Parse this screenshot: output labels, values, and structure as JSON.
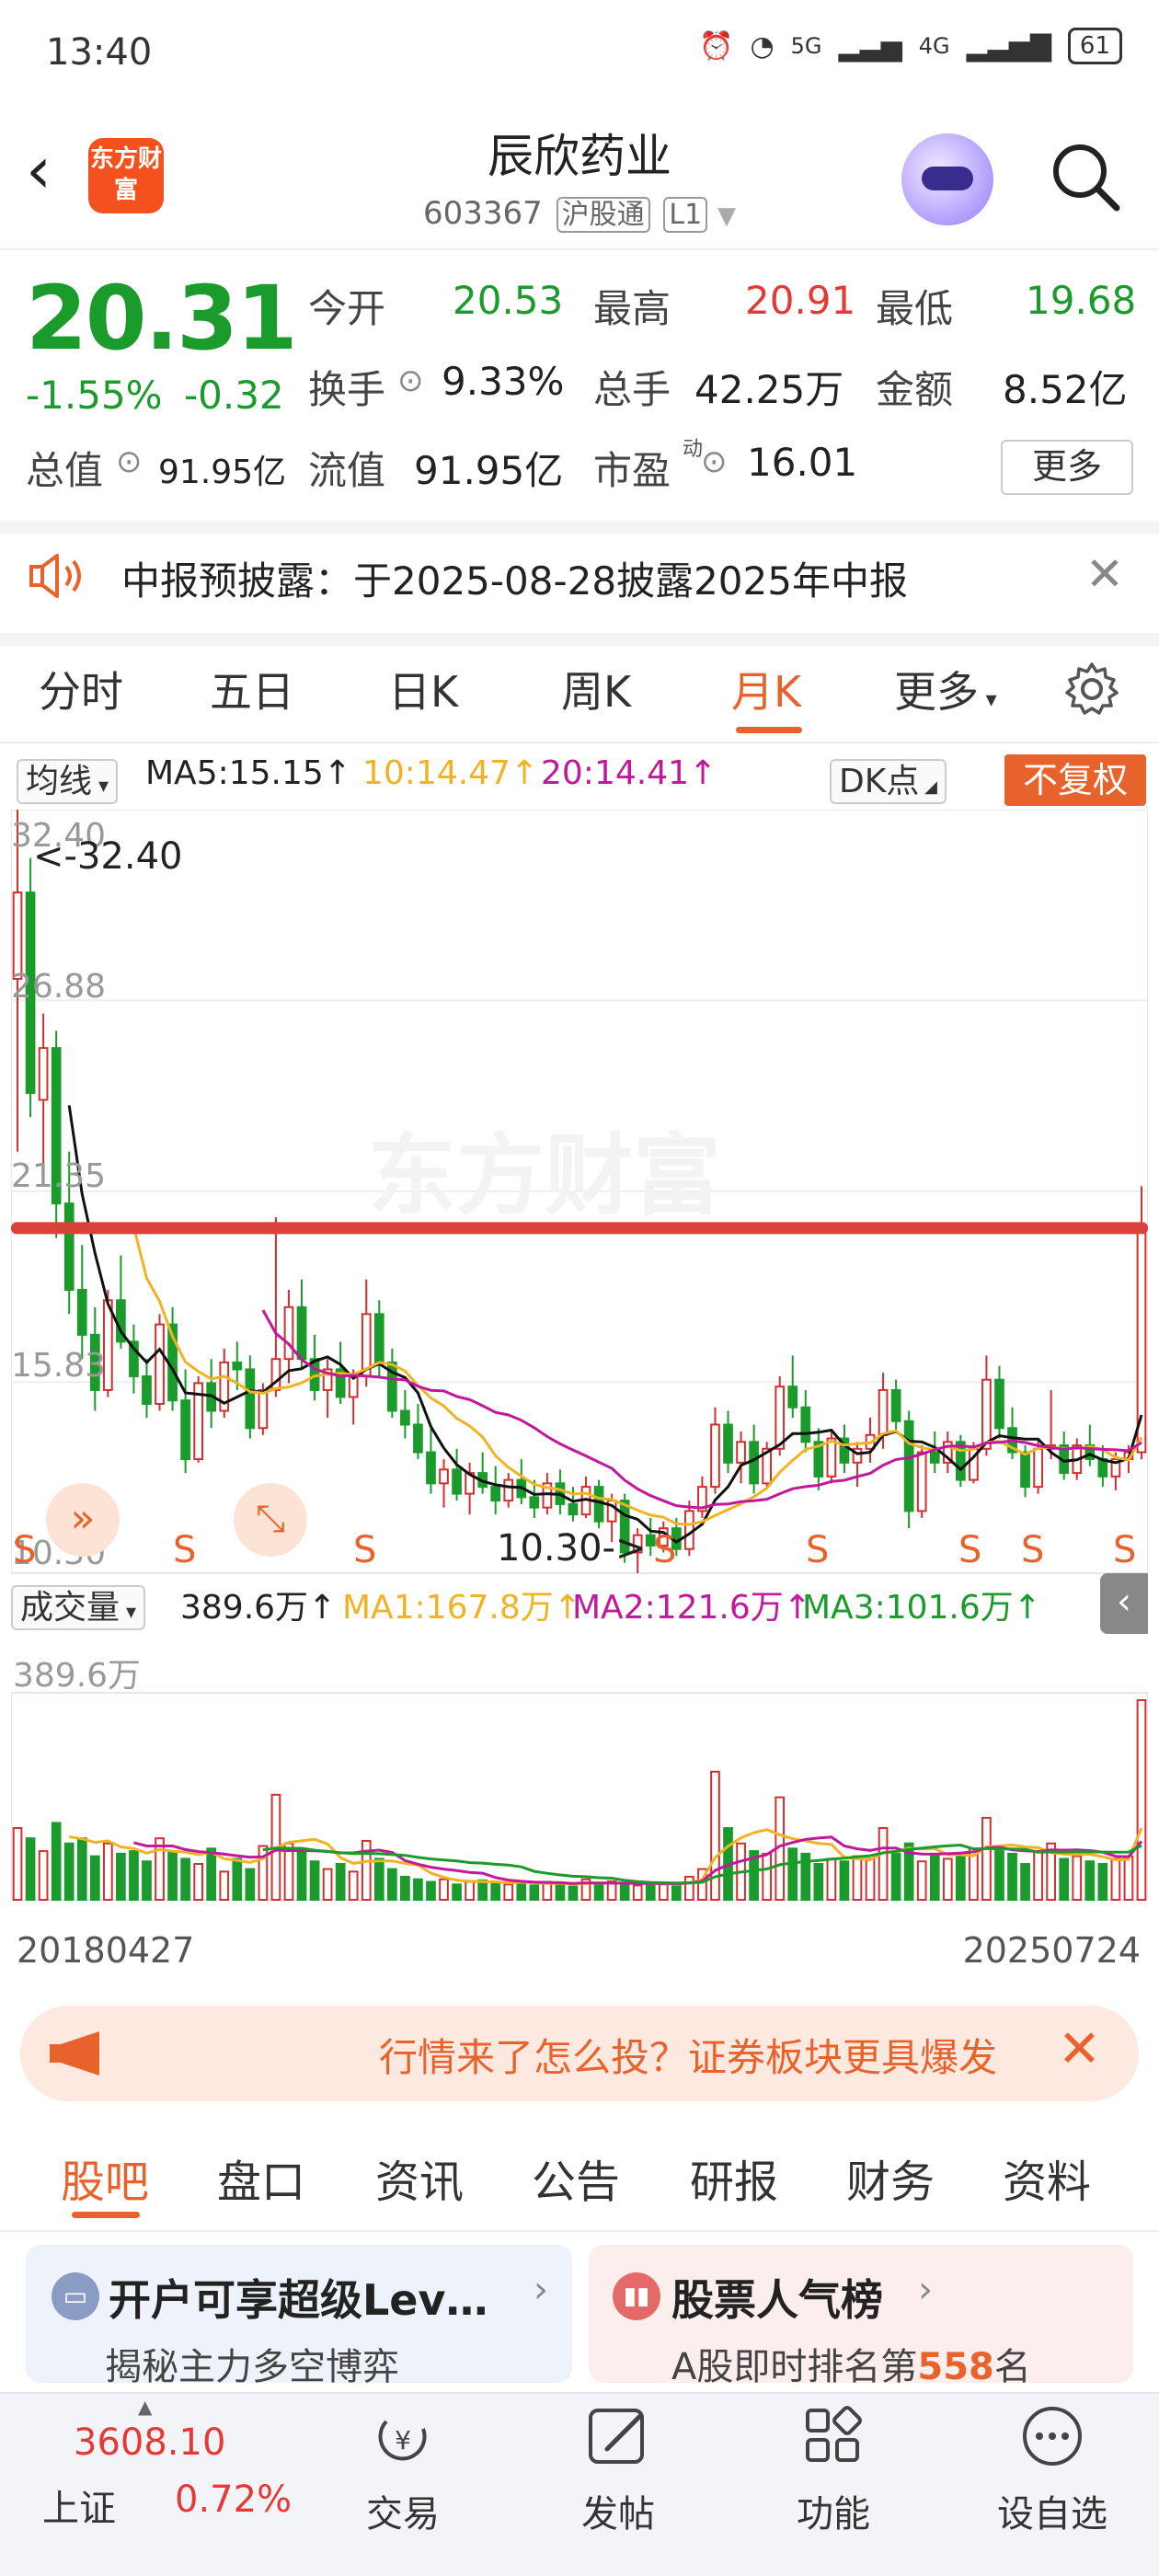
{
  "status": {
    "time": "13:40",
    "net1": "5G",
    "net2": "4G",
    "battery": "61"
  },
  "header": {
    "title": "辰欣药业",
    "code": "603367",
    "exchange_tag": "沪股通",
    "level_tag": "L1",
    "logo_text": "东方财富"
  },
  "quote": {
    "price": "20.31",
    "change_pct": "-1.55%",
    "change": "-0.32",
    "open_label": "今开",
    "open": "20.53",
    "high_label": "最高",
    "high": "20.91",
    "low_label": "最低",
    "low": "19.68",
    "turnover_label": "换手",
    "turnover": "9.33%",
    "volume_label": "总手",
    "volume": "42.25万",
    "amount_label": "金额",
    "amount": "8.52亿",
    "mktcap_label": "总值",
    "mktcap": "91.95亿",
    "float_label": "流值",
    "float": "91.95亿",
    "pe_label": "市盈",
    "pe_sup": "动",
    "pe": "16.01",
    "more": "更多"
  },
  "notice": {
    "text": "中报预披露：于2025-08-28披露2025年中报"
  },
  "chart_tabs": [
    "分时",
    "五日",
    "日K",
    "周K",
    "月K",
    "更多"
  ],
  "active_chart_tab": "月K",
  "ma": {
    "label": "均线",
    "ma5": "MA5:15.15",
    "ma10": "10:14.47",
    "ma20": "20:14.41",
    "dk": "DK点",
    "fq": "不复权"
  },
  "volume_row": {
    "label": "成交量",
    "value": "389.6万",
    "ma1": "MA1:167.8万",
    "ma2": "MA2:121.6万",
    "ma3": "MA3:101.6万",
    "axis_max": "389.6万"
  },
  "colors": {
    "up": "#d32f2f",
    "down": "#1a9b2b",
    "ma5": "#111111",
    "ma10": "#f0b323",
    "ma20": "#c2189b",
    "accent": "#e8632b",
    "drawn_line": "#d9413a"
  },
  "chart_data": {
    "type": "candlestick",
    "period": "monthly",
    "x_start": "20180427",
    "x_end": "20250724",
    "y_ticks": [
      "32.40",
      "26.88",
      "21.35",
      "15.83",
      "10.30"
    ],
    "ylim": [
      10.3,
      32.4
    ],
    "high_marker": "<-32.40",
    "low_marker": "10.30->",
    "horizontal_line_price": 20.3,
    "signal_markers": [
      "S",
      "S",
      "S",
      "S",
      "S",
      "S",
      "S",
      "S"
    ],
    "candles_ohlc": [
      [
        27.5,
        32.4,
        22.5,
        30.0
      ],
      [
        30.0,
        31.0,
        23.5,
        24.2
      ],
      [
        24.0,
        26.5,
        22.0,
        25.5
      ],
      [
        25.5,
        26.0,
        20.0,
        21.0
      ],
      [
        21.0,
        22.5,
        17.8,
        18.5
      ],
      [
        18.5,
        19.8,
        16.5,
        17.2
      ],
      [
        17.2,
        18.0,
        15.0,
        15.6
      ],
      [
        15.6,
        18.5,
        15.4,
        18.2
      ],
      [
        18.2,
        19.5,
        16.8,
        17.0
      ],
      [
        17.0,
        17.5,
        15.5,
        16.0
      ],
      [
        16.0,
        16.5,
        14.8,
        15.2
      ],
      [
        15.2,
        17.8,
        15.0,
        17.5
      ],
      [
        17.5,
        18.0,
        15.0,
        15.3
      ],
      [
        15.3,
        16.2,
        13.2,
        13.6
      ],
      [
        13.6,
        16.0,
        13.5,
        15.8
      ],
      [
        15.8,
        16.5,
        14.5,
        15.0
      ],
      [
        15.0,
        16.8,
        14.8,
        16.4
      ],
      [
        16.4,
        17.0,
        15.6,
        16.2
      ],
      [
        16.2,
        16.6,
        14.2,
        14.5
      ],
      [
        14.5,
        15.8,
        14.3,
        15.6
      ],
      [
        15.6,
        20.6,
        15.4,
        16.5
      ],
      [
        16.5,
        18.5,
        15.8,
        18.0
      ],
      [
        18.0,
        18.8,
        16.2,
        16.5
      ],
      [
        16.5,
        17.2,
        15.3,
        15.6
      ],
      [
        15.6,
        16.5,
        14.8,
        16.2
      ],
      [
        16.2,
        17.0,
        15.2,
        15.4
      ],
      [
        15.4,
        16.2,
        14.6,
        16.0
      ],
      [
        16.0,
        18.8,
        15.7,
        17.8
      ],
      [
        17.8,
        18.2,
        16.0,
        16.4
      ],
      [
        16.4,
        16.8,
        14.8,
        15.0
      ],
      [
        15.0,
        15.6,
        14.2,
        14.6
      ],
      [
        14.6,
        15.2,
        13.6,
        13.8
      ],
      [
        13.8,
        14.5,
        12.6,
        12.9
      ],
      [
        12.9,
        13.6,
        12.2,
        13.3
      ],
      [
        13.3,
        13.9,
        12.4,
        12.6
      ],
      [
        12.6,
        13.5,
        12.0,
        13.2
      ],
      [
        13.2,
        13.8,
        12.6,
        12.8
      ],
      [
        12.8,
        13.4,
        12.0,
        12.4
      ],
      [
        12.4,
        13.2,
        12.2,
        13.0
      ],
      [
        13.0,
        13.6,
        12.3,
        12.5
      ],
      [
        12.5,
        13.0,
        11.9,
        12.2
      ],
      [
        12.2,
        13.2,
        12.0,
        12.9
      ],
      [
        12.9,
        13.3,
        12.0,
        12.3
      ],
      [
        12.3,
        12.8,
        11.8,
        12.0
      ],
      [
        12.0,
        13.1,
        11.9,
        12.8
      ],
      [
        12.8,
        13.0,
        11.6,
        11.8
      ],
      [
        11.8,
        12.6,
        11.2,
        12.4
      ],
      [
        12.4,
        12.6,
        10.6,
        10.9
      ],
      [
        10.9,
        11.6,
        10.3,
        11.4
      ],
      [
        11.4,
        11.9,
        10.8,
        11.1
      ],
      [
        11.1,
        11.8,
        10.9,
        11.6
      ],
      [
        11.6,
        11.9,
        10.8,
        11.0
      ],
      [
        11.0,
        12.4,
        10.8,
        12.1
      ],
      [
        12.1,
        13.1,
        11.9,
        12.8
      ],
      [
        12.8,
        15.1,
        12.6,
        14.6
      ],
      [
        14.6,
        15.0,
        13.2,
        13.5
      ],
      [
        13.5,
        14.4,
        12.9,
        14.1
      ],
      [
        14.1,
        14.6,
        12.6,
        12.9
      ],
      [
        12.9,
        14.1,
        12.8,
        13.9
      ],
      [
        13.9,
        16.0,
        13.7,
        15.7
      ],
      [
        15.7,
        16.6,
        14.8,
        15.1
      ],
      [
        15.1,
        15.6,
        13.8,
        14.1
      ],
      [
        14.1,
        14.5,
        12.7,
        13.1
      ],
      [
        13.1,
        14.4,
        12.9,
        14.2
      ],
      [
        14.2,
        14.6,
        13.2,
        13.5
      ],
      [
        13.5,
        14.1,
        12.8,
        13.9
      ],
      [
        13.9,
        14.8,
        13.5,
        14.3
      ],
      [
        14.3,
        16.1,
        13.9,
        15.6
      ],
      [
        15.6,
        15.9,
        14.4,
        14.7
      ],
      [
        14.7,
        15.0,
        11.6,
        12.1
      ],
      [
        12.1,
        14.0,
        11.9,
        13.8
      ],
      [
        13.8,
        14.4,
        13.2,
        13.5
      ],
      [
        13.5,
        14.4,
        13.2,
        14.1
      ],
      [
        14.1,
        14.3,
        12.8,
        13.0
      ],
      [
        13.0,
        14.1,
        12.9,
        13.9
      ],
      [
        13.9,
        16.6,
        13.7,
        15.9
      ],
      [
        15.9,
        16.3,
        14.2,
        14.5
      ],
      [
        14.5,
        15.1,
        13.6,
        13.8
      ],
      [
        13.8,
        14.0,
        12.5,
        12.8
      ],
      [
        12.8,
        14.2,
        12.6,
        13.9
      ],
      [
        13.9,
        15.6,
        13.6,
        14.0
      ],
      [
        14.0,
        14.4,
        13.0,
        13.2
      ],
      [
        13.2,
        14.2,
        13.0,
        14.0
      ],
      [
        14.0,
        14.6,
        13.4,
        13.6
      ],
      [
        13.6,
        14.0,
        12.8,
        13.1
      ],
      [
        13.1,
        13.8,
        12.7,
        13.6
      ],
      [
        13.6,
        14.0,
        13.2,
        13.8
      ],
      [
        13.8,
        21.5,
        13.6,
        20.3
      ]
    ],
    "volumes_wan": [
      140,
      120,
      95,
      150,
      110,
      120,
      85,
      110,
      90,
      95,
      75,
      120,
      95,
      80,
      70,
      100,
      55,
      80,
      60,
      105,
      205,
      110,
      95,
      75,
      60,
      70,
      55,
      115,
      80,
      60,
      45,
      40,
      35,
      40,
      30,
      35,
      38,
      32,
      30,
      36,
      28,
      35,
      30,
      26,
      40,
      32,
      36,
      30,
      28,
      34,
      30,
      28,
      45,
      60,
      250,
      140,
      110,
      95,
      90,
      200,
      100,
      90,
      70,
      80,
      75,
      85,
      80,
      140,
      90,
      110,
      75,
      85,
      80,
      90,
      100,
      160,
      95,
      90,
      70,
      95,
      110,
      80,
      85,
      75,
      70,
      80,
      85,
      389.6
    ]
  },
  "banner": {
    "text": "行情来了怎么投？证券板块更具爆发"
  },
  "bottom_tabs": [
    "股吧",
    "盘口",
    "资讯",
    "公告",
    "研报",
    "财务",
    "资料"
  ],
  "cards": [
    {
      "title": "开户可享超级Lev…",
      "sub": "揭秘主力多空博弈"
    },
    {
      "title": "股票人气榜",
      "sub_pre": "A股即时排名第",
      "sub_num": "558",
      "sub_post": "名"
    }
  ],
  "nav": {
    "index_value": "3608.10",
    "index_name": "上证",
    "index_change": "0.72%",
    "trade": "交易",
    "post": "发帖",
    "function": "功能",
    "watch": "设自选"
  }
}
